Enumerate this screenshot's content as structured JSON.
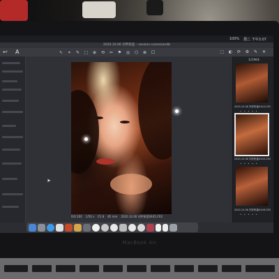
{
  "menubar": {
    "items": [
      "100%",
      "周二 下午3:07"
    ]
  },
  "titlebar": {
    "title": "2020.10.06 刘宇彤宣 – session.cosessiondb"
  },
  "toolbar": {
    "left_glyph": "↩",
    "text_tool_glyph": "A",
    "tool_glyphs": [
      "↖",
      "⌖",
      "✎",
      "⬚",
      "⊕",
      "⟲",
      "✂",
      "⚑",
      "◎",
      "⬡",
      "⊗",
      "☐"
    ],
    "right_glyphs": [
      "⬚",
      "◐",
      "⟳",
      "⚙",
      "✎",
      "✕"
    ]
  },
  "viewer": {
    "status_items": [
      "ISO 200",
      "1/50 s",
      "f/1.8",
      "85 mm",
      "2020.10.06 刘宇彤宣0445.CR2"
    ]
  },
  "browser": {
    "counter": "1/1964",
    "thumbnails": [
      {
        "label": "2020.10.06 刘宇彤宣0444.CR2",
        "stars": "• • • • •"
      },
      {
        "label": "2020.10.06 刘宇彤宣0445.CR2",
        "stars": "• • • • •"
      },
      {
        "label": "2020.10.06 刘宇彤宣0446.CR2",
        "stars": "• • • • •"
      }
    ]
  },
  "brand": "MacBook Air",
  "colors": {
    "app_background": "#2b2d32",
    "selection_outline": "#e8e8ea",
    "dock": "#46484e"
  }
}
